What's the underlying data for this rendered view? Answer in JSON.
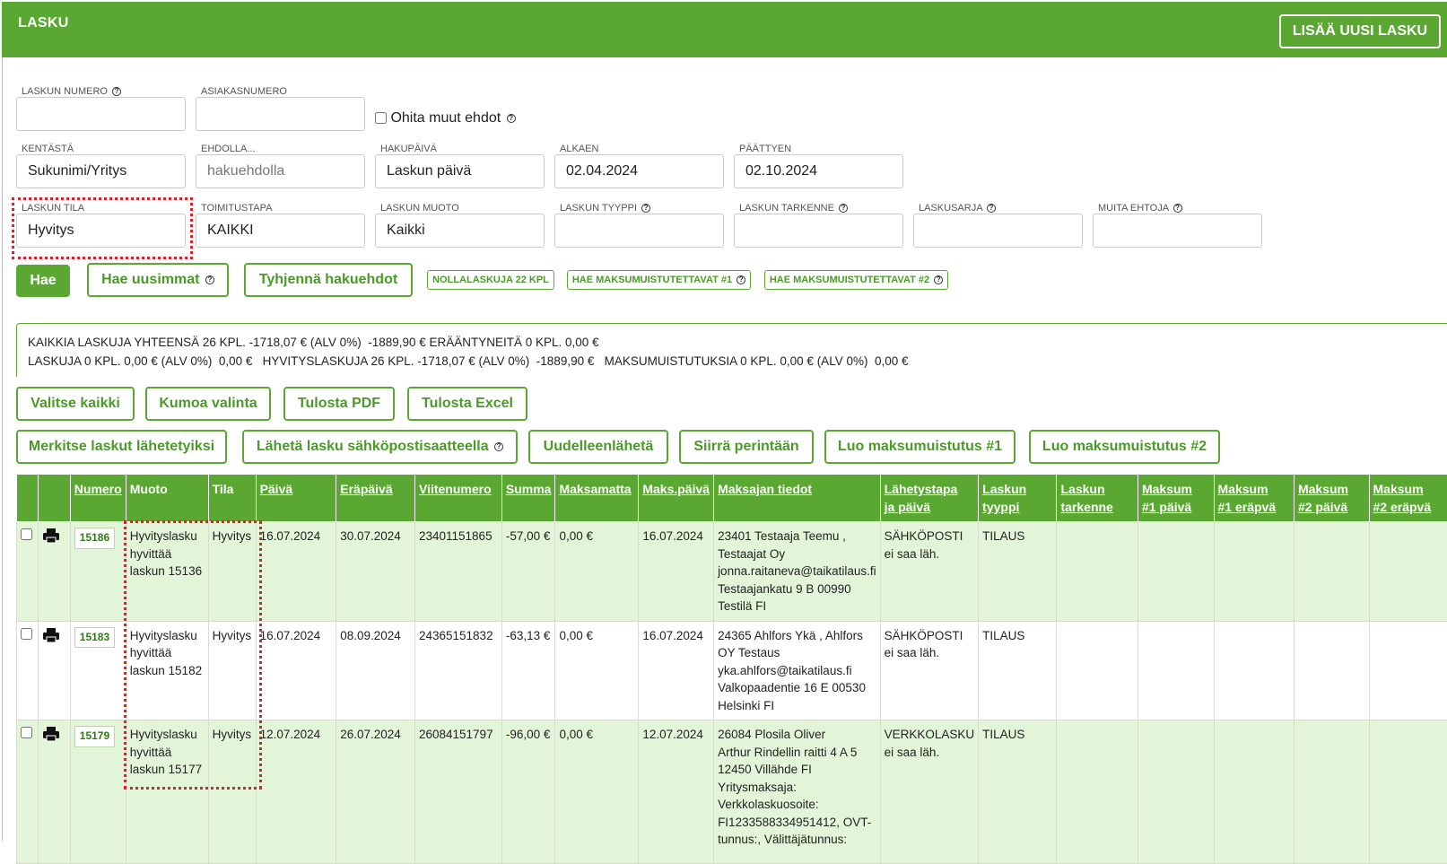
{
  "header": {
    "title": "LASKU",
    "add_button": "LISÄÄ UUSI LASKU"
  },
  "filters": {
    "laskun_numero": {
      "label": "LASKUN NUMERO",
      "value": ""
    },
    "asiakasnumero": {
      "label": "ASIAKASNUMERO",
      "value": ""
    },
    "ohita": {
      "label": "Ohita muut ehdot"
    },
    "kentasta": {
      "label": "KENTÄSTÄ",
      "value": "Sukunimi/Yritys"
    },
    "ehdolla": {
      "label": "EHDOLLA...",
      "placeholder": "hakuehdolla"
    },
    "hakupaiva": {
      "label": "HAKUPÄIVÄ",
      "value": "Laskun päivä"
    },
    "alkaen": {
      "label": "ALKAEN",
      "value": "02.04.2024"
    },
    "paattyen": {
      "label": "PÄÄTTYEN",
      "value": "02.10.2024"
    },
    "laskun_tila": {
      "label": "LASKUN TILA",
      "value": "Hyvitys"
    },
    "toimitustapa": {
      "label": "TOIMITUSTAPA",
      "value": "KAIKKI"
    },
    "laskun_muoto": {
      "label": "LASKUN MUOTO",
      "value": "Kaikki"
    },
    "laskun_tyyppi": {
      "label": "LASKUN TYYPPI",
      "value": ""
    },
    "laskun_tarkenne": {
      "label": "LASKUN TARKENNE",
      "value": ""
    },
    "laskusarja": {
      "label": "LASKUSARJA",
      "value": ""
    },
    "muita_ehtoja": {
      "label": "MUITA EHTOJA",
      "value": ""
    }
  },
  "search_buttons": {
    "hae": "Hae",
    "hae_uusimmat": "Hae uusimmat",
    "tyhjenna": "Tyhjennä hakuehdot",
    "nollalaskuja": "NOLLALASKUJA 22 KPL",
    "muistutus1": "HAE MAKSUMUISTUTETTAVAT #1",
    "muistutus2": "HAE MAKSUMUISTUTETTAVAT #2"
  },
  "summary": {
    "line1": "KAIKKIA LASKUJA YHTEENSÄ 26 KPL. -1718,07 € (ALV 0%)  -1889,90 € ERÄÄNTYNEITÄ 0 KPL. 0,00 €",
    "line2": "LASKUJA 0 KPL. 0,00 € (ALV 0%)  0,00 €   HYVITYSLASKUJA 26 KPL. -1718,07 € (ALV 0%)  -1889,90 €   MAKSUMUISTUTUKSIA 0 KPL. 0,00 € (ALV 0%)  0,00 €"
  },
  "actions": {
    "valitse_kaikki": "Valitse kaikki",
    "kumoa_valinta": "Kumoa valinta",
    "tulosta_pdf": "Tulosta PDF",
    "tulosta_excel": "Tulosta Excel",
    "merkitse": "Merkitse laskut lähetetyiksi",
    "laheta": "Lähetä lasku sähköpostisaatteella",
    "uudelleen": "Uudelleenlähetä",
    "siirra": "Siirrä perintään",
    "luo1": "Luo maksumuistutus #1",
    "luo2": "Luo maksumuistutus #2"
  },
  "table": {
    "headers": {
      "numero": "Numero",
      "muoto": "Muoto",
      "tila": "Tila",
      "paiva": "Päivä",
      "erapaiva": "Eräpäivä",
      "viitenumero": "Viitenumero",
      "summa": "Summa",
      "maksamatta": "Maksamatta",
      "maks_paiva": "Maks.päivä",
      "maksajan_tiedot": "Maksajan tiedot",
      "lahetystapa_1": "Lähetystapa",
      "lahetystapa_2": "ja päivä",
      "laskun_tyyppi_1": "Laskun",
      "laskun_tyyppi_2": "tyyppi",
      "laskun_tarkenne_1": "Laskun",
      "laskun_tarkenne_2": "tarkenne",
      "m1p_1": "Maksum",
      "m1p_2": "#1 päivä",
      "m1e_1": "Maksum",
      "m1e_2": "#1 eräpvä",
      "m2p_1": "Maksum",
      "m2p_2": "#2 päivä",
      "m2e_1": "Maksum",
      "m2e_2": "#2 eräpvä"
    },
    "rows": [
      {
        "numero": "15186",
        "muoto_1": "Hyvityslasku",
        "muoto_2": "hyvittää",
        "muoto_3": "laskun 15136",
        "tila": "Hyvitys",
        "paiva": "16.07.2024",
        "erapaiva": "30.07.2024",
        "viitenumero": "23401151865",
        "summa": "-57,00 €",
        "maksamatta": "0,00 €",
        "maks_paiva": "16.07.2024",
        "maksaja": [
          "23401 Testaaja Teemu ,",
          "Testaajat Oy",
          "jonna.raitaneva@taikatilaus.fi",
          "Testaajankatu 9 B 00990",
          "Testilä FI"
        ],
        "lahetys_1": "SÄHKÖPOSTI",
        "lahetys_2": "ei saa läh.",
        "tyyppi": "TILAUS"
      },
      {
        "numero": "15183",
        "muoto_1": "Hyvityslasku",
        "muoto_2": "hyvittää",
        "muoto_3": "laskun 15182",
        "tila": "Hyvitys",
        "paiva": "16.07.2024",
        "erapaiva": "08.09.2024",
        "viitenumero": "24365151832",
        "summa": "-63,13 €",
        "maksamatta": "0,00 €",
        "maks_paiva": "16.07.2024",
        "maksaja": [
          "24365 Ahlfors Ykä , Ahlfors",
          "OY Testaus",
          "yka.ahlfors@taikatilaus.fi",
          "Valkopaadentie 16 E 00530",
          "Helsinki FI"
        ],
        "lahetys_1": "SÄHKÖPOSTI",
        "lahetys_2": "ei saa läh.",
        "tyyppi": "TILAUS"
      },
      {
        "numero": "15179",
        "muoto_1": "Hyvityslasku",
        "muoto_2": "hyvittää",
        "muoto_3": "laskun 15177",
        "tila": "Hyvitys",
        "paiva": "12.07.2024",
        "erapaiva": "26.07.2024",
        "viitenumero": "26084151797",
        "summa": "-96,00 €",
        "maksamatta": "0,00 €",
        "maks_paiva": "12.07.2024",
        "maksaja": [
          "26084 Plosila Oliver",
          "Arthur Rindellin raitti 4 A 5",
          "12450 Villähde FI",
          "Yritysmaksaja:",
          "Verkkolaskuosoite:",
          "FI1233588334951412, OVT-",
          "tunnus:, Välittäjätunnus:"
        ],
        "lahetys_1": "VERKKOLASKU",
        "lahetys_2": "ei saa läh.",
        "tyyppi": "TILAUS"
      }
    ]
  },
  "colors": {
    "brand": "#5aa832",
    "row_green": "#e3f5d8",
    "highlight": "#d9232b"
  }
}
